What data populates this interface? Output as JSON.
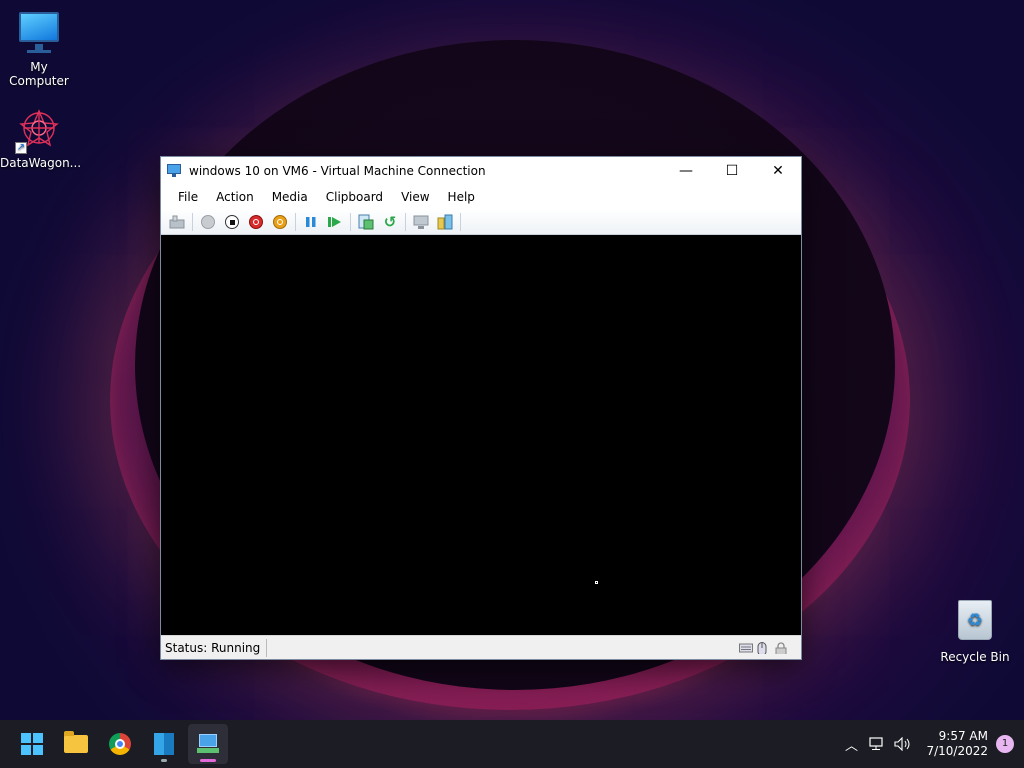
{
  "desktop": {
    "icons": [
      {
        "label": "My Computer"
      },
      {
        "label": "DataWagon..."
      },
      {
        "label": "Recycle Bin"
      }
    ]
  },
  "vm_window": {
    "title": "windows 10 on VM6 - Virtual Machine Connection",
    "controls": {
      "minimize": "—",
      "maximize": "☐",
      "close": "✕"
    },
    "menu": [
      "File",
      "Action",
      "Media",
      "Clipboard",
      "View",
      "Help"
    ],
    "toolbar": [
      "ctrl-alt-del",
      "start",
      "turn-off",
      "shut-down",
      "save",
      "pause",
      "resume",
      "checkpoint",
      "revert",
      "enhanced-session",
      "share"
    ],
    "status": "Status: Running"
  },
  "taskbar": {
    "apps": [
      "start",
      "file-explorer",
      "chrome",
      "server-manager",
      "hyper-v-connection"
    ],
    "clock": {
      "time": "9:57 AM",
      "date": "7/10/2022"
    },
    "notification_count": "1"
  },
  "colors": {
    "taskbar": "#1c1c24",
    "accent": "#4cc2ff",
    "vm_screen": "#000000",
    "active_indicator": "#e06ad8"
  }
}
